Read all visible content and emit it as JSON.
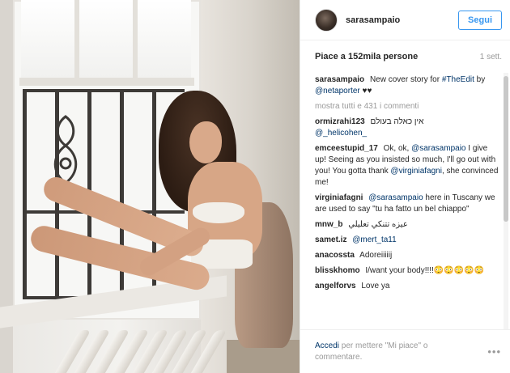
{
  "post": {
    "username": "sarasampaio",
    "follow_label": "Segui",
    "likes_text": "Piace a 152mila persone",
    "time_ago": "1 sett."
  },
  "caption": {
    "user": "sarasampaio",
    "text_1": "New cover story for",
    "tag_1": "#TheEdit",
    "text_2": "by",
    "tag_2": "@netaporter",
    "text_3": "♥♥"
  },
  "show_all": "mostra tutti e 431 i commenti",
  "comments": [
    {
      "user": "ormizrahi123",
      "text": "אין כאלה בעולם",
      "tag": "@_helicohen_",
      "after": ""
    },
    {
      "user": "emceestupid_17",
      "text": "Ok, ok,",
      "tag": "@sarasampaio",
      "after": "I give up! Seeing as you insisted so much, I'll go out with you! You gotta thank",
      "tag2": "@virginiafagni",
      "after2": ", she convinced me!"
    },
    {
      "user": "virginiafagni",
      "text": "",
      "tag": "@sarasampaio",
      "after": "here in Tuscany we are used to say \"tu ha fatto un bel chiappo\""
    },
    {
      "user": "mnw_b",
      "text": "عيزه تتنكي تعليلي",
      "tag": "",
      "after": ""
    },
    {
      "user": "samet.iz",
      "text": "",
      "tag": "@mert_ta11",
      "after": ""
    },
    {
      "user": "anacossta",
      "text": "Adoreiiiiij",
      "tag": "",
      "after": ""
    },
    {
      "user": "blisskhomo",
      "text": "I/want your body!!!!😳😳😳😳😳",
      "tag": "",
      "after": ""
    },
    {
      "user": "angelforvs",
      "text": "Love ya",
      "tag": "",
      "after": ""
    }
  ],
  "footer": {
    "login_link": "Accedi",
    "login_text": "per mettere \"Mi piace\" o commentare.",
    "more_icon": "•••"
  },
  "colors": {
    "accent": "#3897f0",
    "link": "#003569",
    "muted": "#999999",
    "text": "#262626"
  }
}
